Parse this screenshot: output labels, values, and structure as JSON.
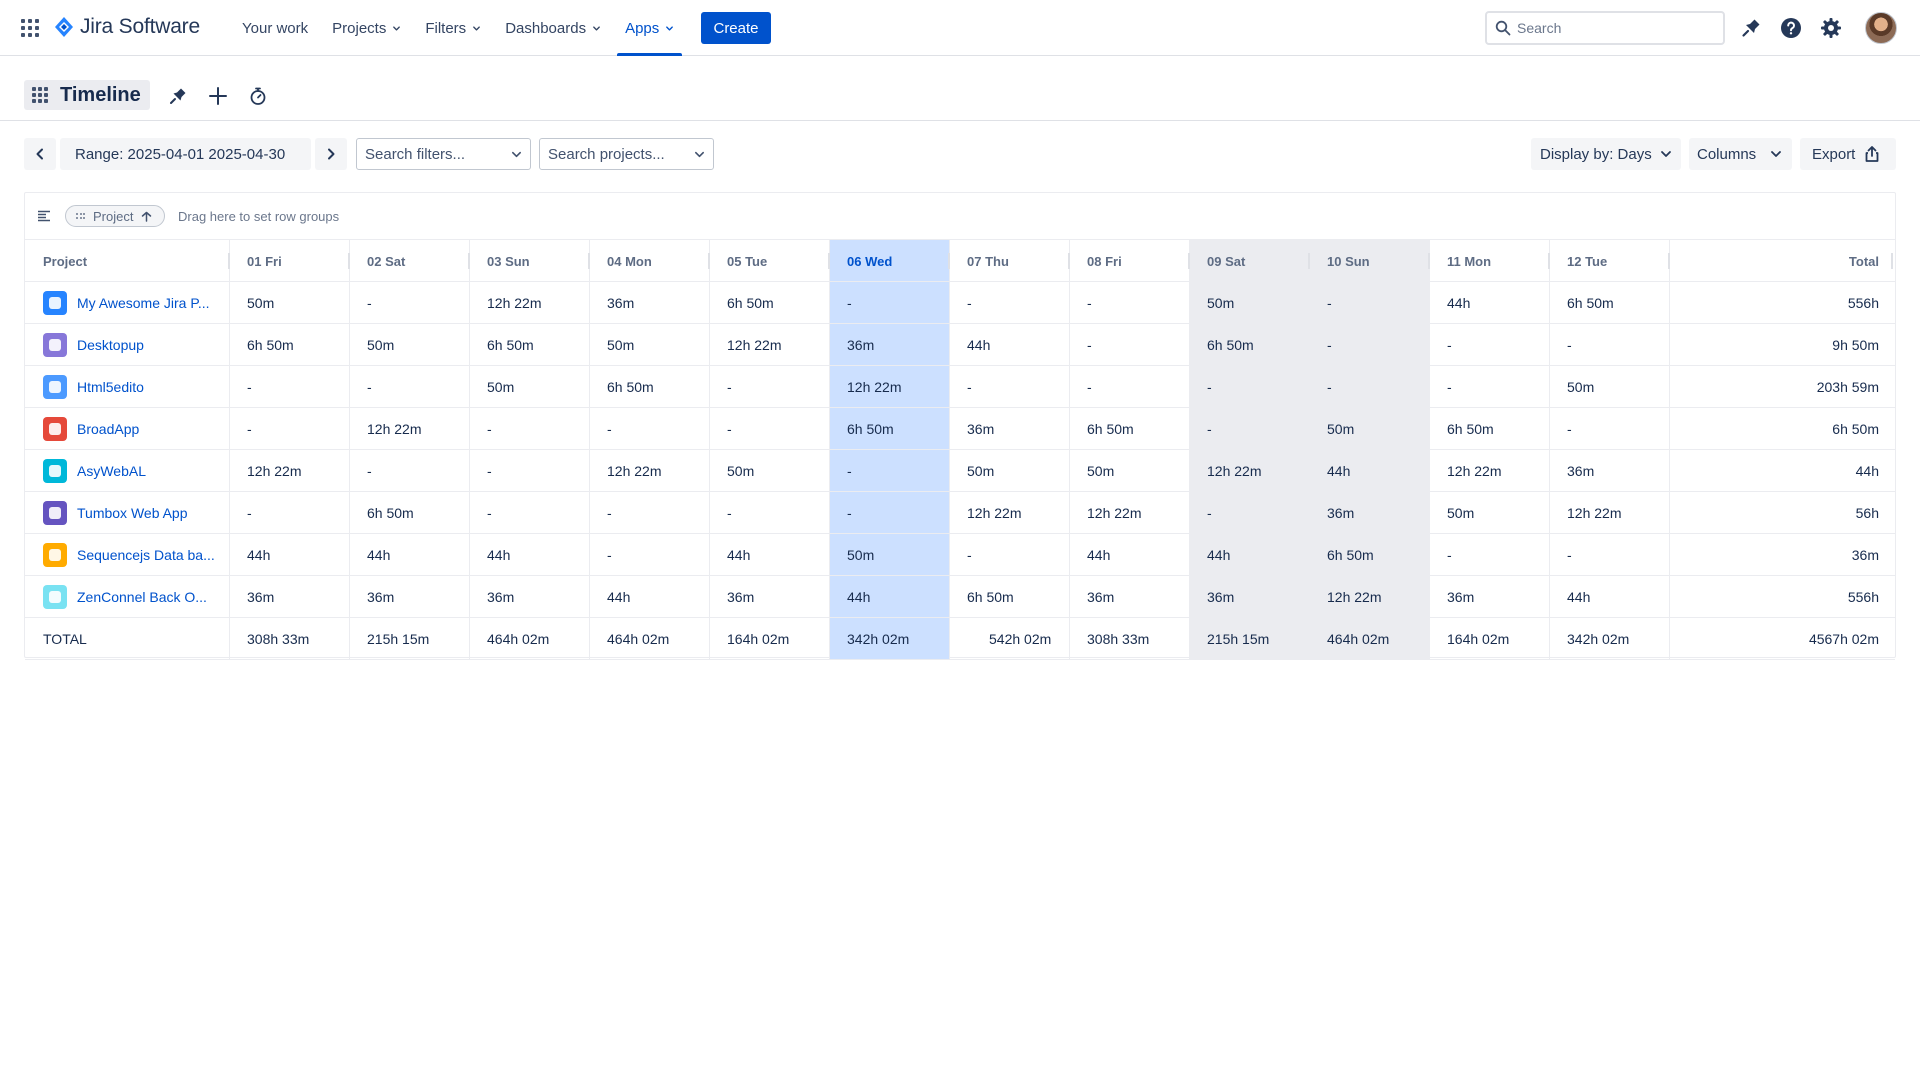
{
  "topnav": {
    "product_name": "Jira Software",
    "items": [
      {
        "label": "Your work",
        "dropdown": false,
        "active": false
      },
      {
        "label": "Projects",
        "dropdown": true,
        "active": false
      },
      {
        "label": "Filters",
        "dropdown": true,
        "active": false
      },
      {
        "label": "Dashboards",
        "dropdown": true,
        "active": false
      },
      {
        "label": "Apps",
        "dropdown": true,
        "active": true
      }
    ],
    "create_label": "Create",
    "search_placeholder": "Search",
    "icons": [
      "notifications-icon",
      "help-icon",
      "settings-icon",
      "avatar"
    ]
  },
  "subheader": {
    "title": "Timeline",
    "icons": [
      "rocket-icon",
      "plus-icon",
      "stopwatch-icon"
    ]
  },
  "toolbar": {
    "range_label": "Range: 2025-04-01 2025-04-30",
    "filter_placeholder": "Search filters...",
    "project_placeholder": "Search projects...",
    "display_by_label": "Display by: Days",
    "columns_label": "Columns",
    "export_label": "Export"
  },
  "grouping": {
    "chip_label": "Project",
    "hint": "Drag here to set row groups"
  },
  "table": {
    "project_header": "Project",
    "total_header": "Total",
    "today_column": "06 Wed",
    "weekend_columns": [
      "09 Sat",
      "10 Sun"
    ],
    "days": [
      "01 Fri",
      "02 Sat",
      "03 Sun",
      "04 Mon",
      "05 Tue",
      "06 Wed",
      "07 Thu",
      "08 Fri",
      "09 Sat",
      "10 Sun",
      "11 Mon",
      "12 Tue"
    ],
    "rows": [
      {
        "project": "My Awesome Jira P...",
        "icon_color": "#2684ff",
        "values": [
          "50m",
          "-",
          "12h 22m",
          "36m",
          "6h 50m",
          "-",
          "-",
          "-",
          "50m",
          "-",
          "44h",
          "6h 50m"
        ],
        "total": "556h"
      },
      {
        "project": "Desktopup",
        "icon_color": "#8777d9",
        "values": [
          "6h 50m",
          "50m",
          "6h 50m",
          "50m",
          "12h 22m",
          "36m",
          "44h",
          "-",
          "6h 50m",
          "-",
          "-",
          "-"
        ],
        "total": "9h 50m"
      },
      {
        "project": "Html5edito",
        "icon_color": "#4c9aff",
        "values": [
          "-",
          "-",
          "50m",
          "6h 50m",
          "-",
          "12h 22m",
          "-",
          "-",
          "-",
          "-",
          "-",
          "50m"
        ],
        "total": "203h 59m"
      },
      {
        "project": "BroadApp",
        "icon_color": "#e5493a",
        "values": [
          "-",
          "12h 22m",
          "-",
          "-",
          "-",
          "6h 50m",
          "36m",
          "6h 50m",
          "-",
          "50m",
          "6h 50m",
          "-"
        ],
        "total": "6h 50m"
      },
      {
        "project": "AsyWebAL",
        "icon_color": "#00b8d9",
        "values": [
          "12h 22m",
          "-",
          "-",
          "12h 22m",
          "50m",
          "-",
          "50m",
          "50m",
          "12h 22m",
          "44h",
          "12h 22m",
          "36m"
        ],
        "total": "44h"
      },
      {
        "project": "Tumbox Web App",
        "icon_color": "#6554c0",
        "values": [
          "-",
          "6h 50m",
          "-",
          "-",
          "-",
          "-",
          "12h 22m",
          "12h 22m",
          "-",
          "36m",
          "50m",
          "12h 22m"
        ],
        "total": "56h"
      },
      {
        "project": "Sequencejs Data ba...",
        "icon_color": "#ffab00",
        "values": [
          "44h",
          "44h",
          "44h",
          "-",
          "44h",
          "50m",
          "-",
          "44h",
          "44h",
          "6h 50m",
          "-",
          "-"
        ],
        "total": "36m"
      },
      {
        "project": "ZenConnel Back O...",
        "icon_color": "#79e2f2",
        "values": [
          "36m",
          "36m",
          "36m",
          "44h",
          "36m",
          "44h",
          "6h 50m",
          "36m",
          "36m",
          "12h 22m",
          "36m",
          "44h"
        ],
        "total": "556h"
      }
    ],
    "total_row": {
      "label": "TOTAL",
      "values": [
        "308h 33m",
        "215h 15m",
        "464h 02m",
        "464h 02m",
        "164h 02m",
        "342h 02m",
        "542h 02m",
        "308h 33m",
        "215h 15m",
        "464h 02m",
        "164h 02m",
        "342h 02m"
      ],
      "total": "4567h 02m"
    }
  },
  "colors": {
    "accent": "#0052cc",
    "today_highlight": "#cce0ff",
    "weekend_highlight": "#ebecf0"
  }
}
